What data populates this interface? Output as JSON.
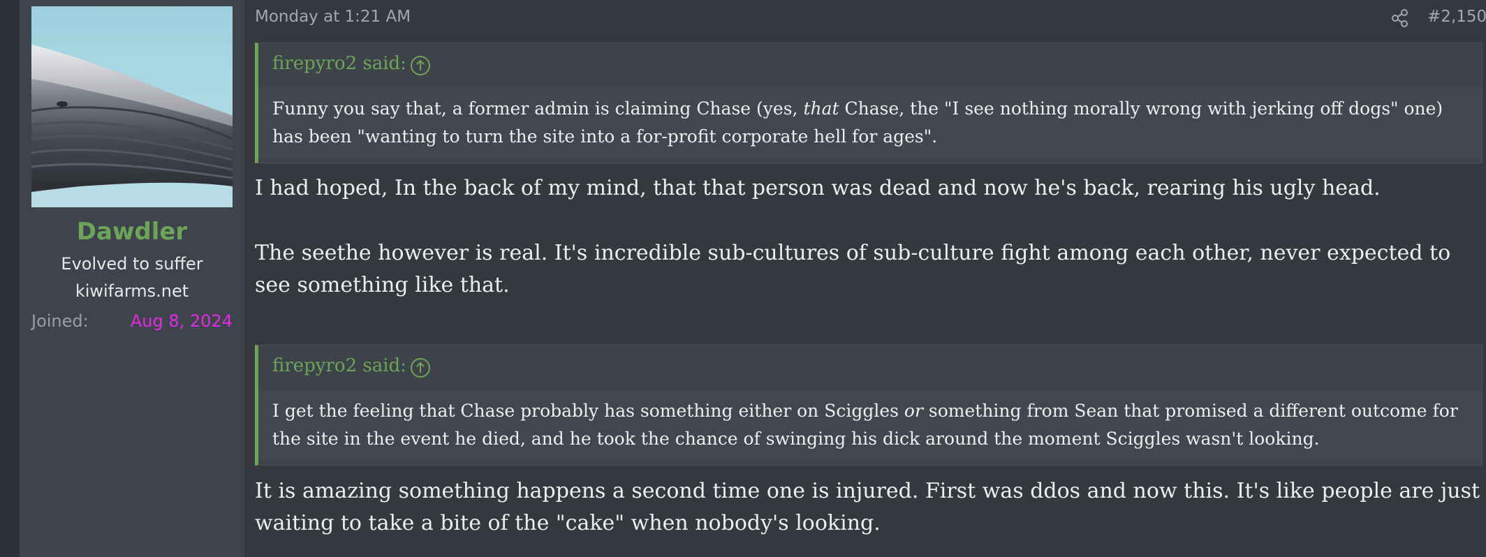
{
  "user": {
    "name": "Dawdler",
    "title_line1": "Evolved to suffer",
    "title_line2": "kiwifarms.net",
    "joined_label": "Joined:",
    "joined_date": "Aug 8, 2024",
    "name_color": "#6ca55a",
    "joined_color": "#e22be6"
  },
  "post": {
    "date": "Monday at 1:21 AM",
    "number": "#2,150",
    "quotes": [
      {
        "author": "firepyro2 said:",
        "text_1": "Funny you say that, a former admin is claiming Chase (yes, ",
        "text_em": "that",
        "text_2": " Chase, the \"I see nothing morally wrong with jerking off dogs\" one) has been \"wanting to turn the site into a for-profit corporate hell for ages\"."
      },
      {
        "author": "firepyro2 said:",
        "text_1": "I get the feeling that Chase probably has something either on Sciggles ",
        "text_em": "or",
        "text_2": " something from Sean that promised a different outcome for the site in the event he died, and he took the chance of swinging his dick around the moment Sciggles wasn't looking."
      }
    ],
    "paragraphs": [
      "I had hoped, In the back of my mind, that that person was dead and now he's back, rearing his ugly head.",
      "The seethe however is real. It's incredible sub-cultures of sub-culture fight among each other, never expected to see something like that.",
      "It is amazing something happens a second time one is injured. First was ddos and now this. It's like people are just waiting to take a bite of the \"cake\" when nobody's looking."
    ]
  },
  "icons": {
    "share": "share-icon",
    "quote_jump": "arrow-up-circle-icon"
  },
  "colors": {
    "background": "#35383f",
    "user_panel": "#3f434b",
    "quote_accent": "#6ca55a"
  }
}
